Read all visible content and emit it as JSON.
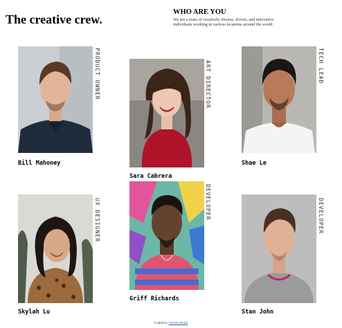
{
  "header": {
    "title": "The creative crew."
  },
  "about": {
    "heading": "WHO ARE YOU",
    "text": "We are a team of creatively diverse, driven, and innovative individuals working in various locations around the world."
  },
  "team": [
    {
      "name": "Bill Mahoney",
      "role": "PRODUCT OWNER",
      "photo": "man-navy-shirt-photo"
    },
    {
      "name": "Sara Cabrera",
      "role": "ART DIRECTOR",
      "photo": "woman-red-sweater-photo"
    },
    {
      "name": "Shae Le",
      "role": "TECH LEAD",
      "photo": "man-white-tshirt-photo"
    },
    {
      "name": "Skylah Lu",
      "role": "UX DESIGNER",
      "photo": "woman-leopard-top-photo"
    },
    {
      "name": "Griff Richards",
      "role": "DEVELOPER",
      "photo": "man-striped-shirt-photo"
    },
    {
      "name": "Stan John",
      "role": "DEVELOPER",
      "photo": "man-grey-sweater-photo"
    }
  ],
  "footer": {
    "prefix": "Coded by",
    "author": "Gerson Smith"
  }
}
